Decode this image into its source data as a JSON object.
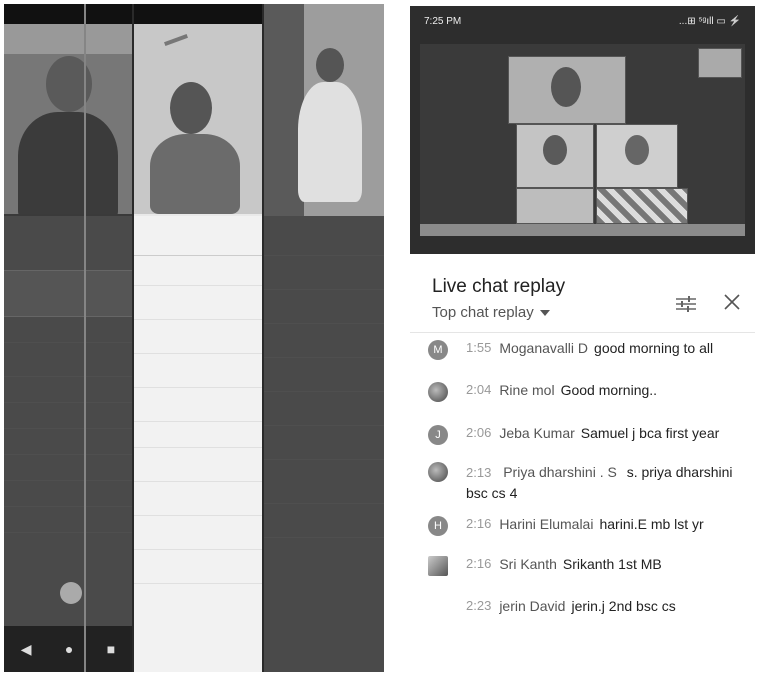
{
  "right_phone": {
    "status_time": "7:25 PM",
    "status_icons": "...⊞ ⁵ᵍıll ▭ ⚡",
    "chat_title": "Live chat replay",
    "chat_mode": "Top chat replay",
    "icons": {
      "filter": "filter-sliders-icon",
      "close": "close-icon"
    },
    "messages": [
      {
        "avatar_letter": "M",
        "time": "1:55",
        "author": "Moganavalli D",
        "text": "good morning to all"
      },
      {
        "avatar_letter": "",
        "time": "2:04",
        "author": "Rine mol",
        "text": "Good morning.."
      },
      {
        "avatar_letter": "J",
        "time": "2:06",
        "author": "Jeba Kumar",
        "text": "Samuel j bca first year"
      },
      {
        "avatar_letter": "",
        "time": "2:13",
        "author": "Priya dharshini . S",
        "text": "s. priya dharshini bsc cs 4"
      },
      {
        "avatar_letter": "H",
        "time": "2:16",
        "author": "Harini Elumalai",
        "text": "harini.E mb lst yr"
      },
      {
        "avatar_letter": "",
        "time": "2:16",
        "author": "Sri Kanth",
        "text": "Srikanth 1st MB"
      },
      {
        "avatar_letter": "",
        "time": "2:23",
        "author": "jerin David",
        "text": "jerin.j 2nd bsc cs"
      }
    ]
  }
}
